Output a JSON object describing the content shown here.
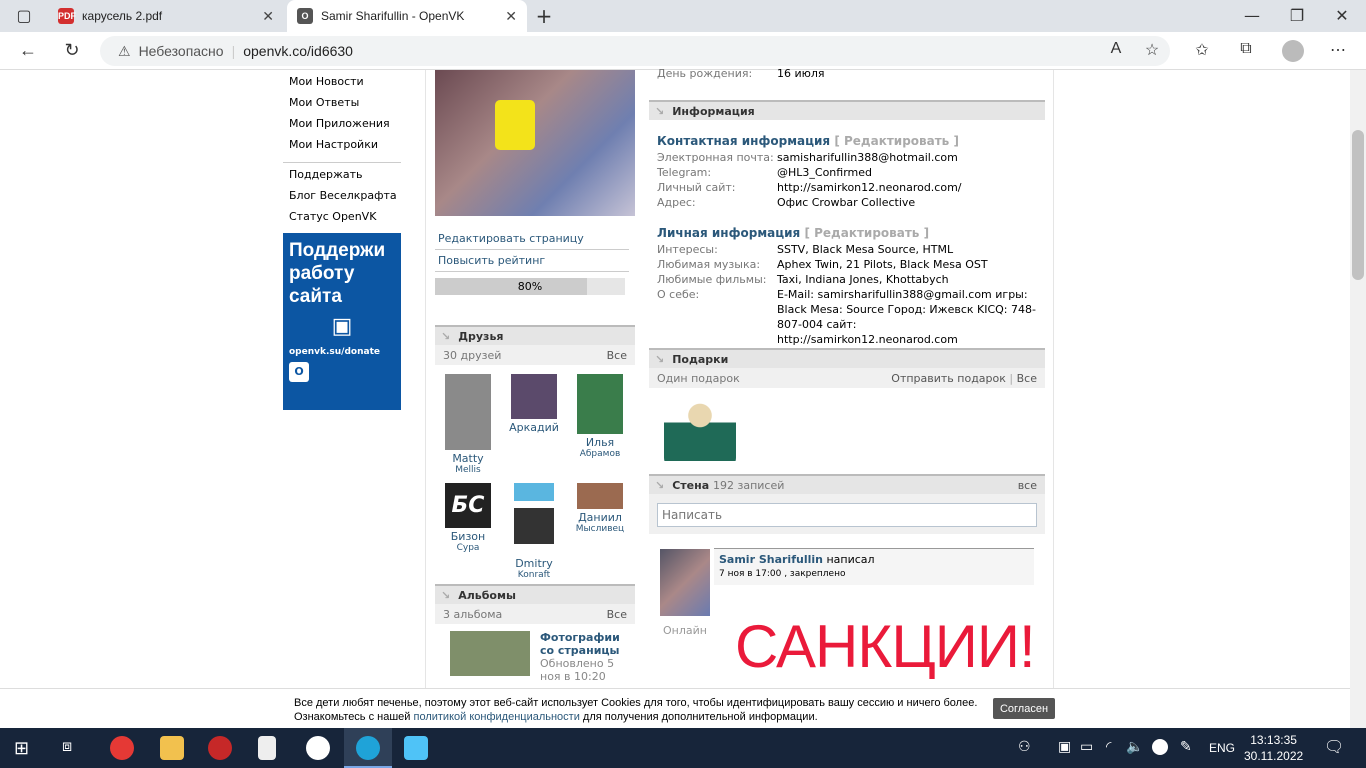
{
  "browser": {
    "tabs": [
      {
        "title": "карусель 2.pdf",
        "icon": "pdf-icon"
      },
      {
        "title": "Samir Sharifullin - OpenVK",
        "icon": "openvk-icon"
      }
    ],
    "security": "Небезопасно",
    "url": "openvk.co/id6630"
  },
  "menu": {
    "items": [
      "Мои Новости",
      "Мои Ответы",
      "Мои Приложения",
      "Мои Настройки"
    ],
    "extra": [
      "Поддержать",
      "Блог Веселкрафта",
      "Статус OpenVK"
    ]
  },
  "banner": {
    "title": "Поддержи работу сайта",
    "link": "openvk.su/donate"
  },
  "profile": {
    "actions": [
      "Редактировать страницу",
      "Повысить рейтинг"
    ],
    "rating_percent": 80,
    "rating_label": "80%"
  },
  "friends": {
    "title": "Друзья",
    "count": "30 друзей",
    "all": "Все",
    "list": [
      {
        "first": "Matty",
        "last": "Mellis"
      },
      {
        "first": "Аркадий",
        "last": ""
      },
      {
        "first": "Илья",
        "last": "Абрамов"
      },
      {
        "first": "Бизон",
        "last": "Сура"
      },
      {
        "first": "Dmitry",
        "last": "Konraft"
      },
      {
        "first": "Даниил",
        "last": "Мысливец"
      }
    ],
    "bizon_avatar_text": "БС"
  },
  "albums": {
    "title": "Альбомы",
    "count": "3 альбома",
    "all": "Все",
    "item": {
      "name": "Фотографии со страницы",
      "updated": "Обновлено 5 ноя в 10:20"
    }
  },
  "birthday": {
    "label": "День рождения:",
    "value": "16 июля"
  },
  "info": {
    "title": "Информация",
    "edit": "[ Редактировать ]",
    "contact": {
      "title": "Контактная информация",
      "rows": [
        {
          "label": "Электронная почта:",
          "value": "samisharifullin388@hotmail.com"
        },
        {
          "label": "Telegram:",
          "value": "@HL3_Confirmed"
        },
        {
          "label": "Личный сайт:",
          "value": "http://samirkon12.neonarod.com/"
        },
        {
          "label": "Адрес:",
          "value": "Офис Crowbar Collective"
        }
      ]
    },
    "personal": {
      "title": "Личная информация",
      "rows": [
        {
          "label": "Интересы:",
          "value": "SSTV, Black Mesa Source, HTML"
        },
        {
          "label": "Любимая музыка:",
          "value": "Aphex Twin, 21 Pilots, Black Mesa OST"
        },
        {
          "label": "Любимые фильмы:",
          "value": "Taxi, Indiana Jones, Khottabych"
        },
        {
          "label": "О себе:",
          "value": "E-Mail: samirsharifullin388@gmail.com игры: Black Mesa: Source Город: Ижевск KICQ: 748-807-004 сайт: http://samirkon12.neonarod.com"
        }
      ]
    }
  },
  "gifts": {
    "title": "Подарки",
    "count": "Один подарок",
    "send": "Отправить подарок",
    "sep": "|",
    "all": "Все"
  },
  "wall": {
    "title": "Стена",
    "count": "192 записей",
    "all": "все",
    "placeholder": "Написать",
    "post": {
      "author": "Samir Sharifullin",
      "action": "написал",
      "meta": "7 ноя в 17:00 , закреплено",
      "status": "Онлайн",
      "image_text": "САНКЦИИ!"
    }
  },
  "cookie": {
    "line1": "Все дети любят печенье, поэтому этот веб-сайт использует Cookies для того, чтобы идентифицировать вашу сессию и ничего более.",
    "line2_pre": "Ознакомьтесь с нашей ",
    "line2_link": "политикой конфиденциальности",
    "line2_post": " для получения дополнительной информации.",
    "button": "Согласен"
  },
  "taskbar": {
    "lang": "ENG",
    "time": "13:13:35",
    "date": "30.11.2022"
  }
}
